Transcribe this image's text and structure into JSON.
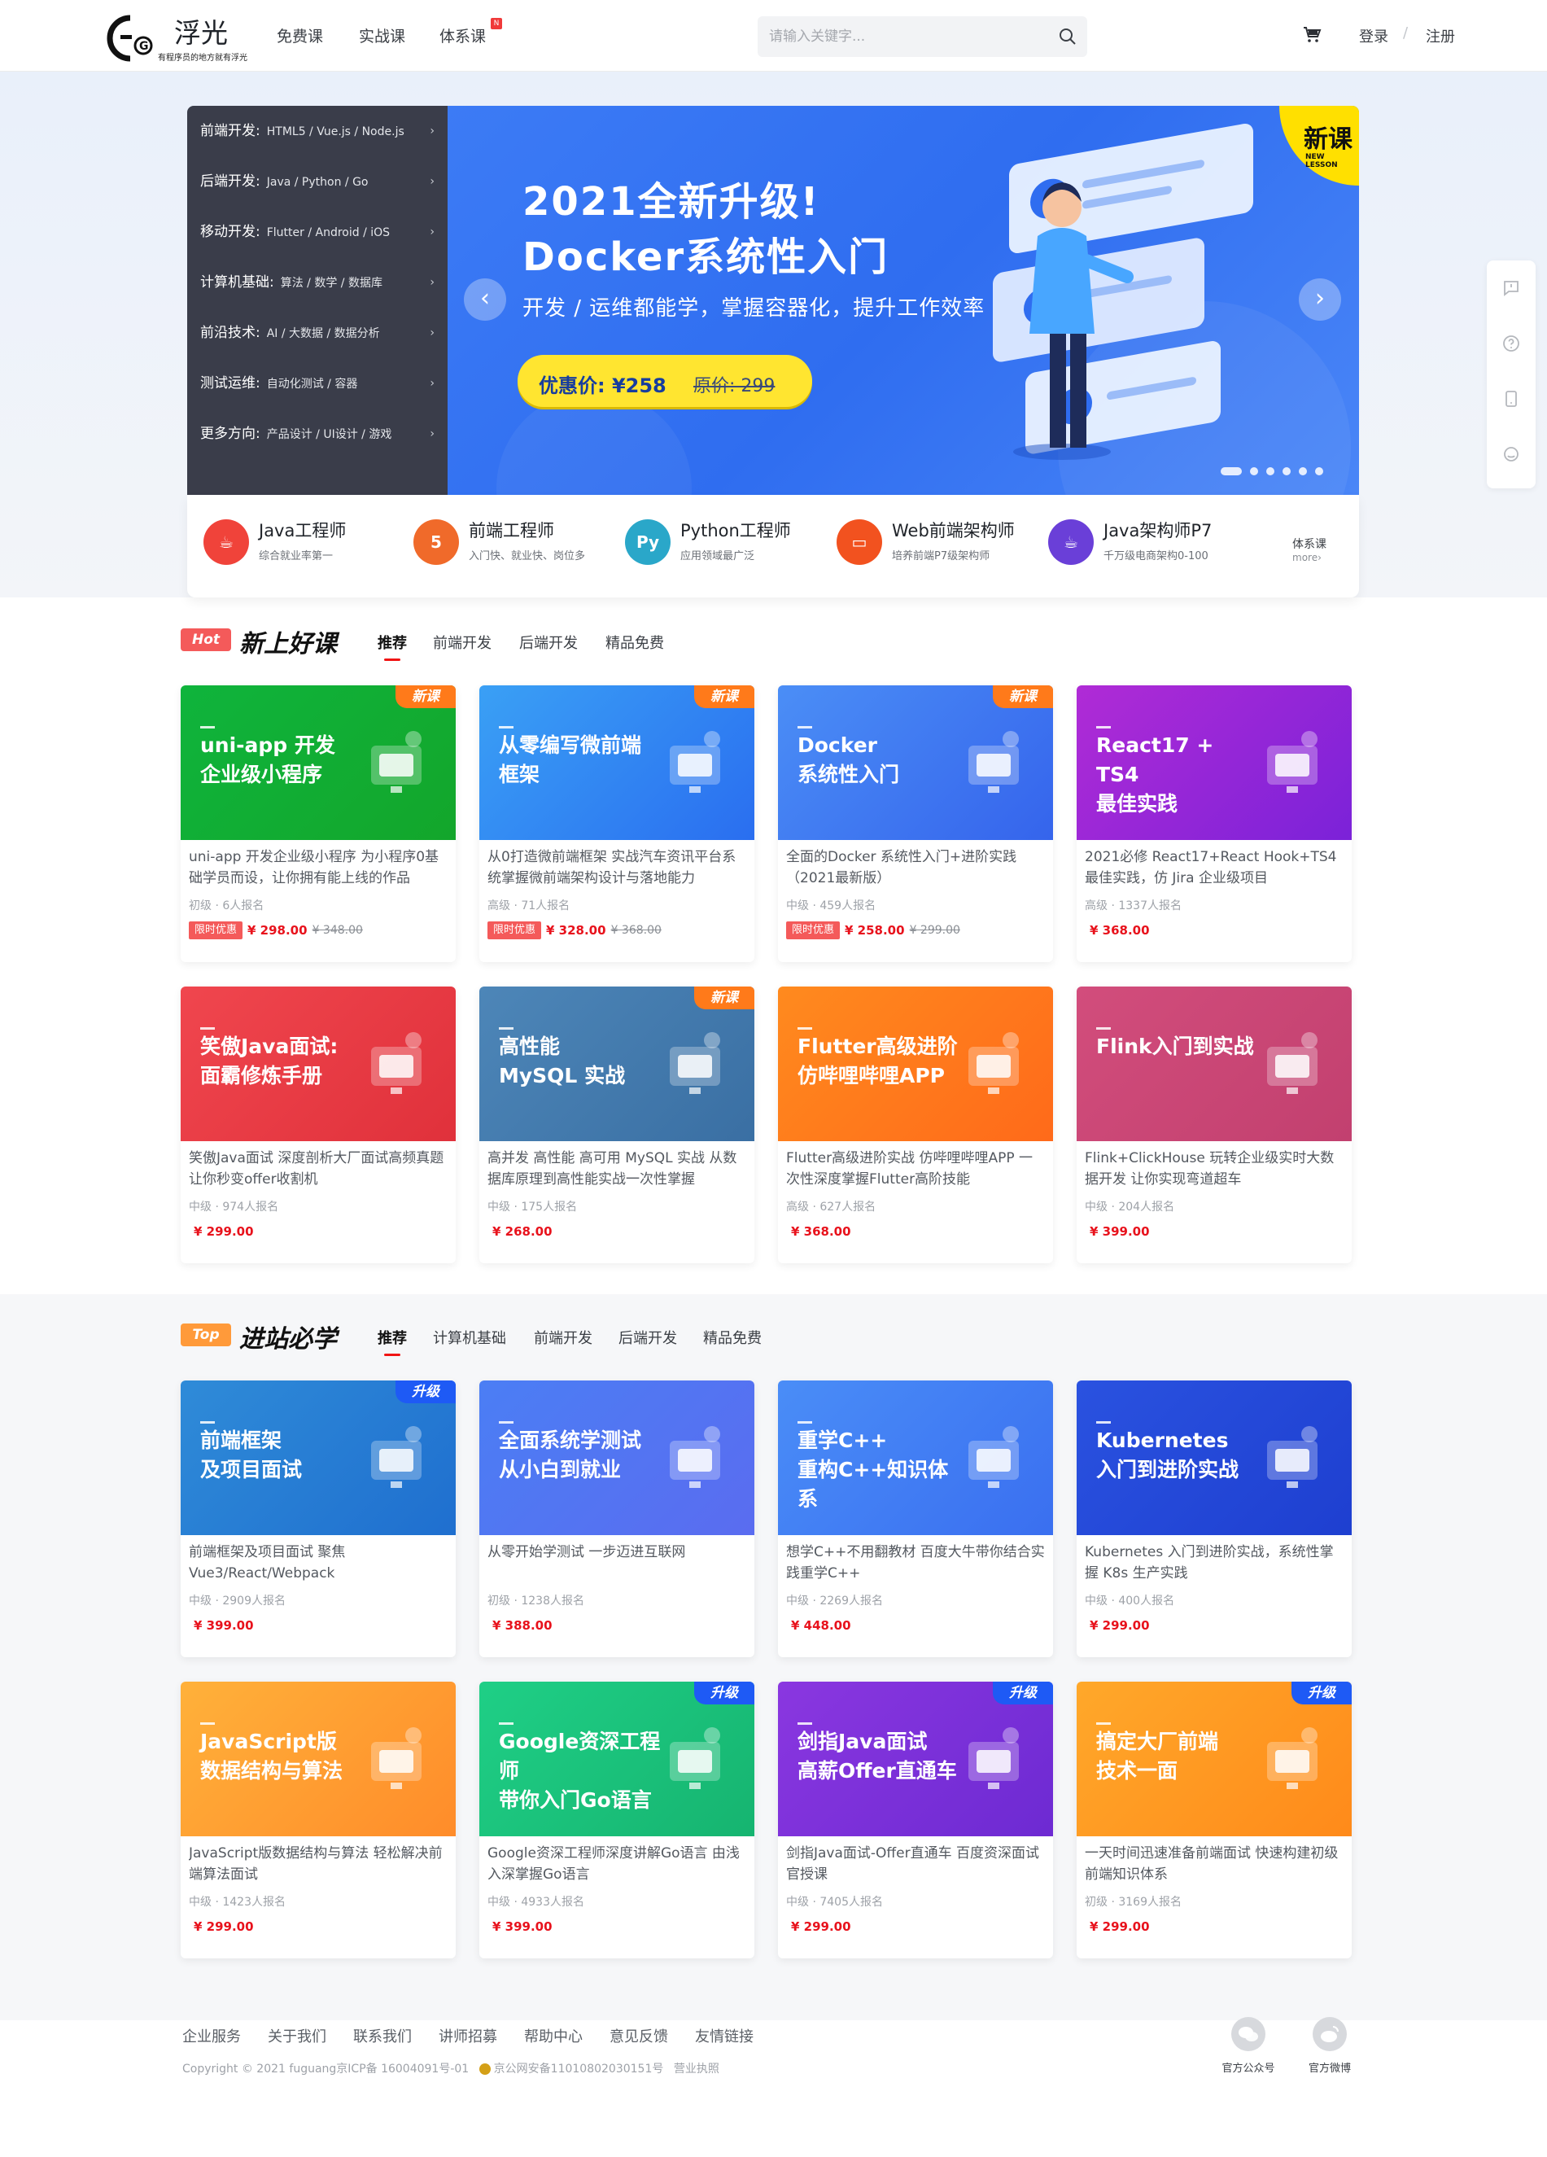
{
  "header": {
    "logo_name": "浮光",
    "logo_slogan": "有程序员的地方就有浮光",
    "nav": [
      "免费课",
      "实战课",
      "体系课"
    ],
    "nav_badge": "N",
    "search_placeholder": "请输入关键字...",
    "login": "登录",
    "divider": "/",
    "register": "注册"
  },
  "banner": {
    "menu": [
      {
        "cat": "前端开发:",
        "sub": "HTML5 / Vue.js / Node.js"
      },
      {
        "cat": "后端开发:",
        "sub": "Java / Python / Go"
      },
      {
        "cat": "移动开发:",
        "sub": "Flutter / Android / iOS"
      },
      {
        "cat": "计算机基础:",
        "sub": "算法 / 数学 / 数据库"
      },
      {
        "cat": "前沿技术:",
        "sub": "AI / 大数据 / 数据分析"
      },
      {
        "cat": "测试运维:",
        "sub": "自动化测试 / 容器"
      },
      {
        "cat": "更多方向:",
        "sub": "产品设计 / UI设计 / 游戏"
      }
    ],
    "headline1": "2021全新升级!",
    "headline2": "Docker系统性入门",
    "subline": "开发 / 运维都能学，掌握容器化，提升工作效率",
    "price_now": "优惠价: ¥258",
    "price_old": "原价: 299",
    "badge_title": "新课",
    "badge_sub": "NEW LESSON",
    "slides": 6,
    "active_slide": 1
  },
  "paths": [
    {
      "title": "Java工程师",
      "sub": "综合就业率第一",
      "icon": "java-cup-icon",
      "color": "#f0433a"
    },
    {
      "title": "前端工程师",
      "sub": "入门快、就业快、岗位多",
      "icon": "html5-shield-icon",
      "color": "#f06a2a"
    },
    {
      "title": "Python工程师",
      "sub": "应用领域最广泛",
      "icon": "python-icon",
      "color": "#2aa7c9"
    },
    {
      "title": "Web前端架构师",
      "sub": "培养前端P7级架构师",
      "icon": "monitor-icon",
      "color": "#f2521f"
    },
    {
      "title": "Java架构师P7",
      "sub": "千万级电商架构0-100",
      "icon": "java-cup-icon",
      "color": "#6a3fd8"
    }
  ],
  "paths_more": {
    "label": "体系课",
    "more": "more›"
  },
  "section1": {
    "tag": "Hot",
    "title": "新上好课",
    "tabs": [
      "推荐",
      "前端开发",
      "后端开发",
      "精品免费"
    ],
    "cards": [
      {
        "cover": "uni-app 开发\n企业级小程序",
        "ribbon": "新课",
        "desc": "uni-app 开发企业级小程序 为小程序0基础学员而设，让你拥有能上线的作品",
        "meta": "初级 · 6人报名",
        "limit": "限时优惠",
        "price": "¥ 298.00",
        "old": "¥ 348.00",
        "grad": "linear-gradient(135deg,#0fb43c,#13a62b)",
        "icon": "mini-program-icon"
      },
      {
        "cover": "从零编写微前端\n框架",
        "ribbon": "新课",
        "desc": "从0打造微前端框架 实战汽车资讯平台系统掌握微前端架构设计与落地能力",
        "meta": "高级 · 71人报名",
        "limit": "限时优惠",
        "price": "¥ 328.00",
        "old": "¥ 368.00",
        "grad": "linear-gradient(135deg,#3aa0f5,#2a6ef0)",
        "icon": "cube-icon"
      },
      {
        "cover": "Docker\n系统性入门",
        "ribbon": "新课",
        "desc": "全面的Docker 系统性入门+进阶实践（2021最新版）",
        "meta": "中级 · 459人报名",
        "limit": "限时优惠",
        "price": "¥ 258.00",
        "old": "¥ 299.00",
        "grad": "linear-gradient(135deg,#4b8ef6,#3564ec)",
        "icon": "code-window-icon"
      },
      {
        "cover": "React17 + TS4\n最佳实践",
        "ribbon": "",
        "desc": "2021必修 React17+React Hook+TS4 最佳实践，仿 Jira 企业级项目",
        "meta": "高级 · 1337人报名",
        "limit": "",
        "price": "¥ 368.00",
        "old": "",
        "grad": "linear-gradient(135deg,#b02bd6,#7b22d8)",
        "icon": "react-atom-icon"
      },
      {
        "cover": "笑傲Java面试:\n面霸修炼手册",
        "ribbon": "",
        "desc": "笑傲Java面试 深度剖析大厂面试高频真题 让你秒变offer收割机",
        "meta": "中级 · 974人报名",
        "limit": "",
        "price": "¥ 299.00",
        "old": "",
        "grad": "linear-gradient(135deg,#f0464e,#e0313b)",
        "icon": "interview-person-icon"
      },
      {
        "cover": "高性能\nMySQL 实战",
        "ribbon": "新课",
        "desc": "高并发 高性能 高可用 MySQL 实战 从数据库原理到高性能实战一次性掌握",
        "meta": "中级 · 175人报名",
        "limit": "",
        "price": "¥ 268.00",
        "old": "",
        "grad": "linear-gradient(135deg,#4d86b8,#3a6fa3)",
        "icon": "database-window-icon"
      },
      {
        "cover": "Flutter高级进阶\n仿哔哩哔哩APP",
        "ribbon": "",
        "desc": "Flutter高级进阶实战 仿哔哩哔哩APP 一次性深度掌握Flutter高阶技能",
        "meta": "高级 · 627人报名",
        "limit": "",
        "price": "¥ 368.00",
        "old": "",
        "grad": "linear-gradient(135deg,#ff8a1e,#ff6a1a)",
        "icon": "flutter-monitor-icon"
      },
      {
        "cover": "Flink入门到实战",
        "ribbon": "",
        "desc": "Flink+ClickHouse 玩转企业级实时大数据开发 让你实现弯道超车",
        "meta": "中级 · 204人报名",
        "limit": "",
        "price": "¥ 399.00",
        "old": "",
        "grad": "linear-gradient(135deg,#d24d7c,#c2406f)",
        "icon": "squirrel-monitor-icon"
      }
    ]
  },
  "section2": {
    "tag": "Top",
    "title": "进站必学",
    "tabs": [
      "推荐",
      "计算机基础",
      "前端开发",
      "后端开发",
      "精品免费"
    ],
    "cards": [
      {
        "cover": "前端框架\n及项目面试",
        "ribbon": "升级",
        "desc": "前端框架及项目面试 聚焦Vue3/React/Webpack",
        "meta": "中级 · 2909人报名",
        "limit": "",
        "price": "¥ 399.00",
        "old": "",
        "grad": "linear-gradient(135deg,#2f8bd8,#1f6fcf)",
        "icon": "tools-doc-icon"
      },
      {
        "cover": "全面系统学测试\n从小白到就业",
        "ribbon": "",
        "desc": "从零开始学测试 一步迈进互联网",
        "meta": "初级 · 1238人报名",
        "limit": "",
        "price": "¥ 388.00",
        "old": "",
        "grad": "linear-gradient(135deg,#4b7ef4,#5a6cf0)",
        "icon": "building-icon"
      },
      {
        "cover": "重学C++\n重构C++知识体系",
        "ribbon": "",
        "desc": "想学C++不用翻教材 百度大牛带你结合实践重学C++",
        "meta": "中级 · 2269人报名",
        "limit": "",
        "price": "¥ 448.00",
        "old": "",
        "grad": "linear-gradient(135deg,#4a8df7,#3a6ff0)",
        "icon": "cpp-cloud-icon"
      },
      {
        "cover": "Kubernetes\n入门到进阶实战",
        "ribbon": "",
        "desc": "Kubernetes 入门到进阶实战，系统性掌握 K8s 生产实践",
        "meta": "中级 · 400人报名",
        "limit": "",
        "price": "¥ 299.00",
        "old": "",
        "grad": "linear-gradient(135deg,#2a52e0,#1e3fd0)",
        "icon": "k8s-monitor-icon"
      },
      {
        "cover": "JavaScript版\n数据结构与算法",
        "ribbon": "",
        "desc": "JavaScript版数据结构与算法 轻松解决前端算法面试",
        "meta": "中级 · 1423人报名",
        "limit": "",
        "price": "¥ 299.00",
        "old": "",
        "grad": "linear-gradient(135deg,#ffb13a,#ff8c2a)",
        "icon": "algorithm-stack-icon"
      },
      {
        "cover": "Google资深工程师\n带你入门Go语言",
        "ribbon": "升级",
        "desc": "Google资深工程师深度讲解Go语言 由浅入深掌握Go语言",
        "meta": "中级 · 4933人报名",
        "limit": "",
        "price": "¥ 399.00",
        "old": "",
        "grad": "linear-gradient(135deg,#1fcf86,#16b470)",
        "icon": "go-bag-icon"
      },
      {
        "cover": "剑指Java面试\n高薪Offer直通车",
        "ribbon": "升级",
        "desc": "剑指Java面试-Offer直通车 百度资深面试官授课",
        "meta": "中级 · 7405人报名",
        "limit": "",
        "price": "¥ 299.00",
        "old": "",
        "grad": "linear-gradient(135deg,#8a37e0,#6d2ad2)",
        "icon": "java-file-icon"
      },
      {
        "cover": "搞定大厂前端\n技术一面",
        "ribbon": "升级",
        "desc": "一天时间迅速准备前端面试 快速构建初级前端知识体系",
        "meta": "初级 · 3169人报名",
        "limit": "",
        "price": "¥ 299.00",
        "old": "",
        "grad": "linear-gradient(135deg,#ffa82a,#ff8a1a)",
        "icon": "folder-code-icon"
      }
    ]
  },
  "footer": {
    "links": [
      "企业服务",
      "关于我们",
      "联系我们",
      "讲师招募",
      "帮助中心",
      "意见反馈",
      "友情链接"
    ],
    "copyright": "Copyright © 2021 fuguang京ICP备 16004091号-01",
    "police": "京公网安备11010802030151号",
    "license": "营业执照",
    "social": [
      {
        "label": "官方公众号",
        "icon": "wechat-icon"
      },
      {
        "label": "官方微博",
        "icon": "weibo-icon"
      }
    ]
  }
}
